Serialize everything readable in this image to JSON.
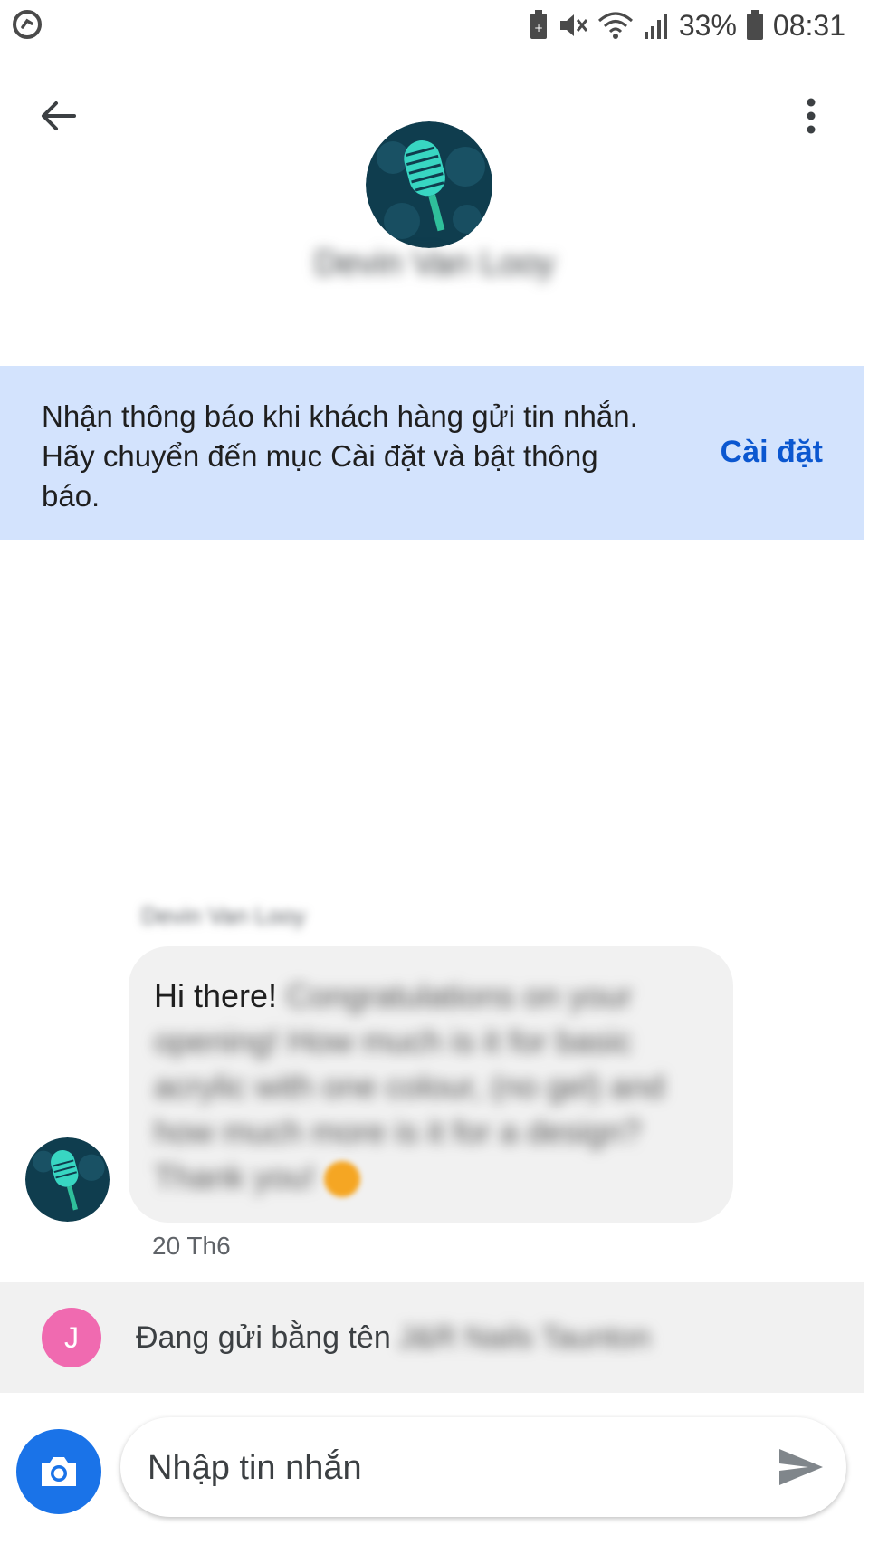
{
  "status_bar": {
    "battery_percent": "33%",
    "time": "08:31",
    "icons": [
      "app-notification-icon",
      "battery-saver-icon",
      "mute-icon",
      "wifi-icon",
      "signal-icon",
      "battery-icon"
    ]
  },
  "header": {
    "back_icon": "arrow-back-icon",
    "more_icon": "more-vert-icon",
    "contact_name": "Devin Van Looy"
  },
  "banner": {
    "text": "Nhận thông báo khi khách hàng gửi tin nhắn. Hãy chuyển đến mục Cài đặt và bật thông báo.",
    "action_label": "Cài đặt"
  },
  "conversation": {
    "sender_name": "Devin Van Looy",
    "message_visible": "Hi there!",
    "message_blurred": "Congratulations on your opening! How much is it for basic acrylic with one colour, (no gel) and how much more is it for a design? Thank you!",
    "timestamp": "20 Th6"
  },
  "sending_as": {
    "avatar_letter": "J",
    "label": "Đang gửi bằng tên",
    "name": "J&R Nails Taunton"
  },
  "composer": {
    "placeholder": "Nhập tin nhắn",
    "camera_icon": "camera-icon",
    "send_icon": "send-icon"
  },
  "colors": {
    "banner_bg": "#d3e3fd",
    "accent": "#0b57d0",
    "camera_button": "#1a73e8",
    "bubble_bg": "#f1f1f1",
    "sending_avatar": "#f06ab0"
  }
}
